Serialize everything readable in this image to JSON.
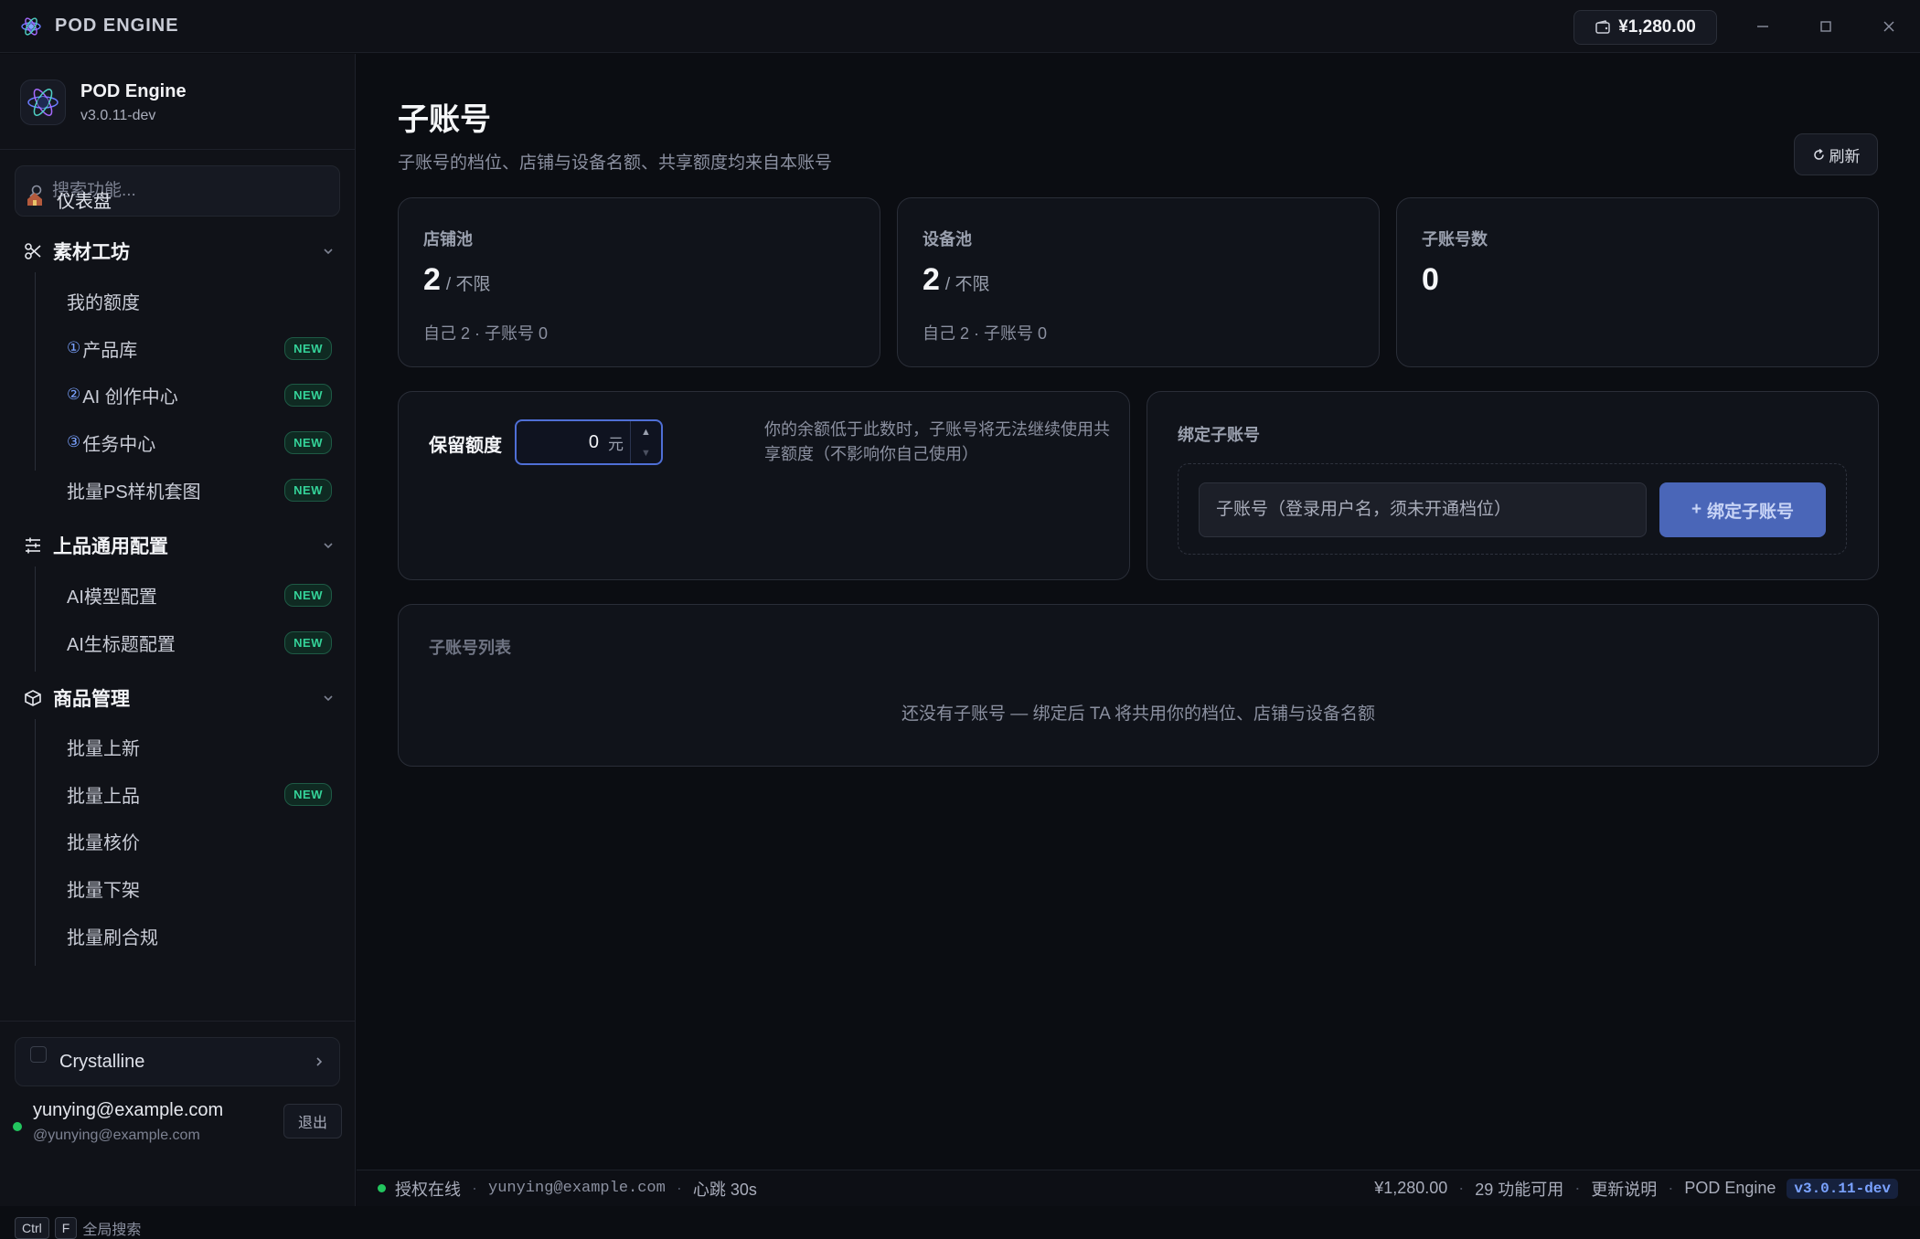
{
  "titlebar": {
    "app_title": "POD ENGINE",
    "balance": "¥1,280.00"
  },
  "sidebar": {
    "brand_name": "POD Engine",
    "brand_version": "v3.0.11-dev",
    "search_placeholder": "搜索功能...",
    "dashboard": "仪表盘",
    "groups": [
      {
        "label": "素材工坊",
        "items": [
          {
            "label": "我的额度",
            "badge": ""
          },
          {
            "label": "产品库",
            "num": "1",
            "badge": "NEW"
          },
          {
            "label": "AI 创作中心",
            "num": "2",
            "badge": "NEW"
          },
          {
            "label": "任务中心",
            "num": "3",
            "badge": "NEW"
          },
          {
            "label": "批量PS样机套图",
            "badge": "NEW"
          }
        ]
      },
      {
        "label": "上品通用配置",
        "items": [
          {
            "label": "AI模型配置",
            "badge": "NEW"
          },
          {
            "label": "AI生标题配置",
            "badge": "NEW"
          }
        ]
      },
      {
        "label": "商品管理",
        "items": [
          {
            "label": "批量上新",
            "badge": ""
          },
          {
            "label": "批量上品",
            "badge": "NEW"
          },
          {
            "label": "批量核价",
            "badge": ""
          },
          {
            "label": "批量下架",
            "badge": ""
          },
          {
            "label": "批量刷合规",
            "badge": ""
          }
        ]
      }
    ],
    "theme": "Crystalline",
    "user_email": "yunying@example.com",
    "user_handle": "@yunying@example.com",
    "logout": "退出",
    "kbd_ctrl": "Ctrl",
    "kbd_f": "F",
    "kbd_hint": "全局搜索"
  },
  "main": {
    "title": "子账号",
    "subtitle": "子账号的档位、店铺与设备名额、共享额度均来自本账号",
    "refresh": "刷新",
    "stats": [
      {
        "label": "店铺池",
        "value": "2",
        "unit": "/ 不限",
        "foot": "自己 2 · 子账号 0"
      },
      {
        "label": "设备池",
        "value": "2",
        "unit": "/ 不限",
        "foot": "自己 2 · 子账号 0"
      },
      {
        "label": "子账号数",
        "value": "0",
        "unit": "",
        "foot": ""
      }
    ],
    "reserve": {
      "label": "保留额度",
      "value": "0",
      "unit": "元",
      "hint": "你的余额低于此数时，子账号将无法继续使用共享额度（不影响你自己使用）"
    },
    "bind": {
      "title": "绑定子账号",
      "placeholder": "子账号（登录用户名，须未开通档位）",
      "button": "绑定子账号"
    },
    "list": {
      "title": "子账号列表",
      "empty": "还没有子账号 — 绑定后 TA 将共用你的档位、店铺与设备名额"
    }
  },
  "statusbar": {
    "auth": "授权在线",
    "user": "yunying@example.com",
    "heartbeat": "心跳 30s",
    "balance": "¥1,280.00",
    "features": "29 功能可用",
    "changelog": "更新说明",
    "app": "POD Engine",
    "version": "v3.0.11-dev"
  },
  "colors": {
    "accent": "#4f6fd6",
    "badge_green": "#34d399",
    "online": "#22c55e"
  }
}
